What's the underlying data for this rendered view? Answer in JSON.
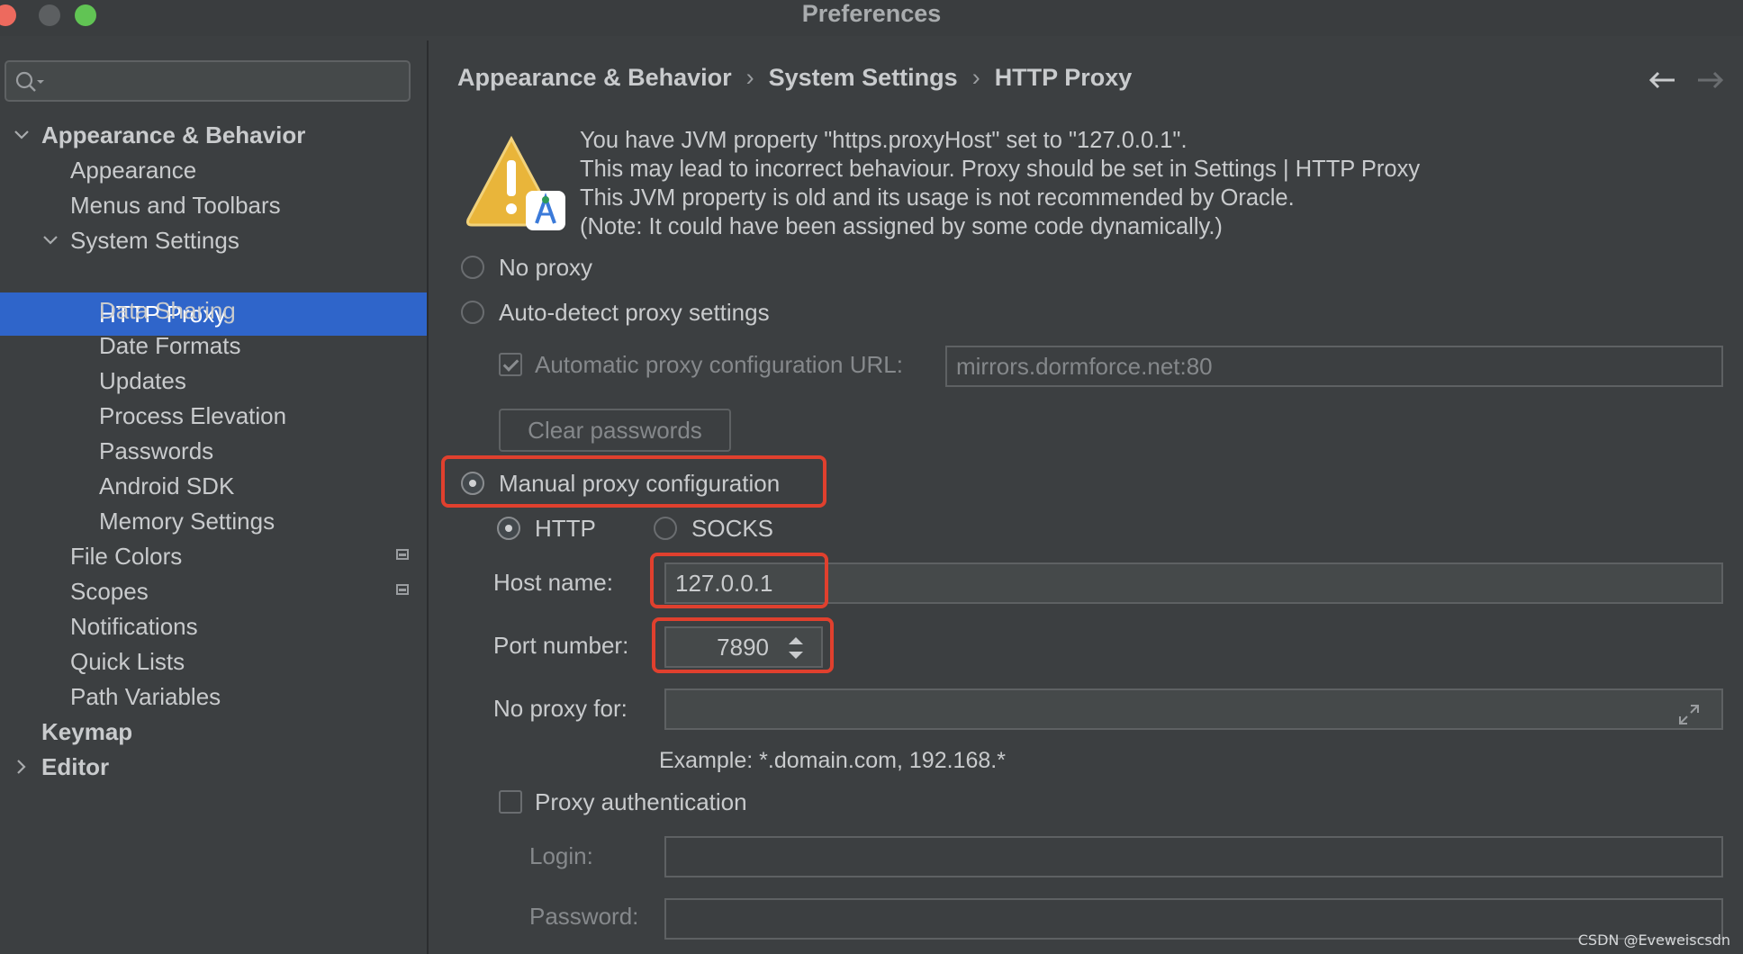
{
  "window": {
    "title": "Preferences"
  },
  "sidebar": {
    "search_placeholder": "",
    "items": [
      {
        "label": "Appearance & Behavior"
      },
      {
        "label": "Appearance"
      },
      {
        "label": "Menus and Toolbars"
      },
      {
        "label": "System Settings"
      },
      {
        "label": "HTTP Proxy"
      },
      {
        "label": "Data Sharing"
      },
      {
        "label": "Date Formats"
      },
      {
        "label": "Updates"
      },
      {
        "label": "Process Elevation"
      },
      {
        "label": "Passwords"
      },
      {
        "label": "Android SDK"
      },
      {
        "label": "Memory Settings"
      },
      {
        "label": "File Colors"
      },
      {
        "label": "Scopes"
      },
      {
        "label": "Notifications"
      },
      {
        "label": "Quick Lists"
      },
      {
        "label": "Path Variables"
      },
      {
        "label": "Keymap"
      },
      {
        "label": "Editor"
      }
    ],
    "selected": "HTTP Proxy"
  },
  "breadcrumb": [
    "Appearance & Behavior",
    "System Settings",
    "HTTP Proxy"
  ],
  "warning": {
    "lines": [
      "You have JVM property \"https.proxyHost\" set to \"127.0.0.1\".",
      "This may lead to incorrect behaviour. Proxy should be set in Settings | HTTP Proxy",
      "This JVM property is old and its usage is not recommended by Oracle.",
      "(Note: It could have been assigned by some code dynamically.)"
    ]
  },
  "proxy": {
    "no_proxy_label": "No proxy",
    "auto_detect_label": "Auto-detect proxy settings",
    "auto_config_url_label": "Automatic proxy configuration URL:",
    "auto_config_url_value": "mirrors.dormforce.net:80",
    "clear_passwords_label": "Clear passwords",
    "manual_label": "Manual proxy configuration",
    "http_label": "HTTP",
    "socks_label": "SOCKS",
    "host_label": "Host name:",
    "host_value": "127.0.0.1",
    "port_label": "Port number:",
    "port_value": "7890",
    "no_proxy_for_label": "No proxy for:",
    "no_proxy_for_value": "",
    "example_text": "Example: *.domain.com, 192.168.*",
    "auth_label": "Proxy authentication",
    "login_label": "Login:",
    "password_label": "Password:",
    "selected_mode": "manual",
    "selected_protocol": "HTTP"
  },
  "watermark": "CSDN @Eveweiscsdn",
  "colors": {
    "selection": "#2f65ca",
    "highlight_box": "#e0402e"
  }
}
